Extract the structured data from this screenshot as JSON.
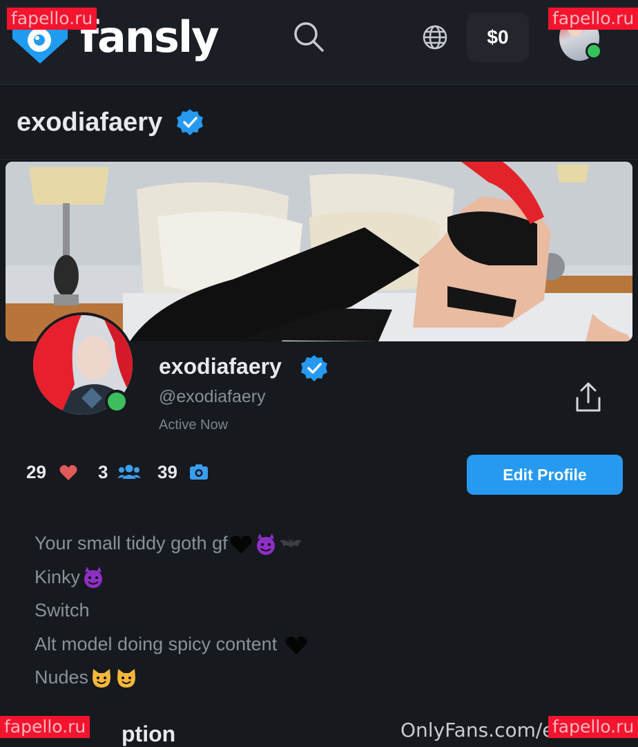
{
  "brand": {
    "name": "fansly",
    "accent": "#2699f0",
    "logo_blue": "#1f9bf0"
  },
  "topbar": {
    "wallet_label": "$0",
    "online_color": "#35c45a"
  },
  "watermarks": {
    "top_left": "fapello.ru",
    "top_right": "fapello.ru",
    "bottom_left": "fapello.ru",
    "bottom_right": "fapello.ru",
    "footer_source": "OnlyFans.com/exodiafaery"
  },
  "header": {
    "username": "exodiafaery",
    "verified_icon": "verified-badge-icon"
  },
  "profile": {
    "display_name": "exodiafaery",
    "handle": "@exodiafaery",
    "status": "Active Now",
    "stats": {
      "likes": "29",
      "likes_icon": "heart-icon",
      "subscribers": "3",
      "subscribers_icon": "users-icon",
      "media": "39",
      "media_icon": "camera-icon"
    },
    "edit_button_label": "Edit Profile"
  },
  "bio": {
    "lines": [
      "Your small tiddy goth gf",
      "Kinky",
      "Switch",
      "Alt model doing spicy content ",
      "Nudes"
    ]
  },
  "section": {
    "heading_partial": "ption"
  }
}
